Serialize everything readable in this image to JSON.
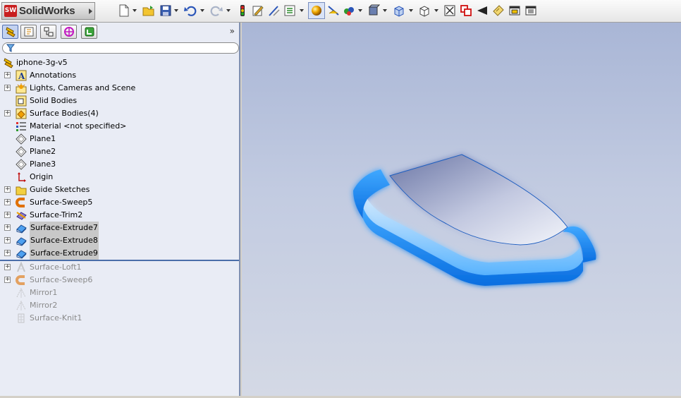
{
  "app": {
    "logo_badge": "SW",
    "logo_text": "SolidWorks"
  },
  "toolbar": {
    "icons": [
      "new-document-icon",
      "open-folder-icon",
      "save-icon",
      "undo-icon",
      "redo-icon",
      "rebuild-icon",
      "edit-sketch-icon",
      "smart-dimension-icon",
      "properties-icon",
      "appearance-icon",
      "section-view-icon",
      "scene-icon",
      "display-style-icon",
      "view-orientation-icon",
      "hide-show-icon",
      "zoom-to-fit-icon",
      "zoom-area-icon",
      "previous-view-icon",
      "note-icon",
      "options-icon",
      "customize-icon"
    ]
  },
  "panel": {
    "tabs": [
      "featuremanager-tab",
      "propertymanager-tab",
      "configurationmanager-tab",
      "dimxpert-tab",
      "display-manager-tab"
    ],
    "chevron": "»",
    "tree": [
      {
        "label": "iphone-3g-v5",
        "icon": "part-icon",
        "root": true,
        "expand": false,
        "state": "normal"
      },
      {
        "label": "Annotations",
        "icon": "annotations-icon",
        "expand": true,
        "state": "normal"
      },
      {
        "label": "Lights, Cameras and Scene",
        "icon": "lights-icon",
        "expand": true,
        "state": "normal"
      },
      {
        "label": "Solid Bodies",
        "icon": "solid-bodies-icon",
        "expand": false,
        "state": "normal"
      },
      {
        "label": "Surface Bodies(4)",
        "icon": "surface-bodies-icon",
        "expand": true,
        "state": "normal"
      },
      {
        "label": "Material <not specified>",
        "icon": "material-icon",
        "expand": false,
        "state": "normal"
      },
      {
        "label": "Plane1",
        "icon": "plane-icon",
        "expand": false,
        "state": "normal"
      },
      {
        "label": "Plane2",
        "icon": "plane-icon",
        "expand": false,
        "state": "normal"
      },
      {
        "label": "Plane3",
        "icon": "plane-icon",
        "expand": false,
        "state": "normal"
      },
      {
        "label": "Origin",
        "icon": "origin-icon",
        "expand": false,
        "state": "normal"
      },
      {
        "label": "Guide Sketches",
        "icon": "folder-icon",
        "expand": true,
        "state": "normal"
      },
      {
        "label": "Surface-Sweep5",
        "icon": "sweep-icon",
        "expand": true,
        "state": "normal"
      },
      {
        "label": "Surface-Trim2",
        "icon": "trim-icon",
        "expand": true,
        "state": "normal"
      },
      {
        "label": "Surface-Extrude7",
        "icon": "extrude-icon",
        "expand": true,
        "state": "selected"
      },
      {
        "label": "Surface-Extrude8",
        "icon": "extrude-icon",
        "expand": true,
        "state": "selected"
      },
      {
        "label": "Surface-Extrude9",
        "icon": "extrude-icon",
        "expand": true,
        "state": "selected"
      },
      {
        "label": "Surface-Loft1",
        "icon": "loft-icon",
        "expand": true,
        "state": "suppressed"
      },
      {
        "label": "Surface-Sweep6",
        "icon": "sweep-icon",
        "expand": true,
        "state": "suppressed"
      },
      {
        "label": "Mirror1",
        "icon": "mirror-icon",
        "expand": false,
        "state": "suppressed"
      },
      {
        "label": "Mirror2",
        "icon": "mirror-icon",
        "expand": false,
        "state": "suppressed"
      },
      {
        "label": "Surface-Knit1",
        "icon": "knit-icon",
        "expand": false,
        "state": "suppressed"
      }
    ]
  },
  "viewport": {
    "model": "phone-surface-model",
    "highlight_color": "#1a8cff",
    "surface_color": "#9aa3c8"
  }
}
